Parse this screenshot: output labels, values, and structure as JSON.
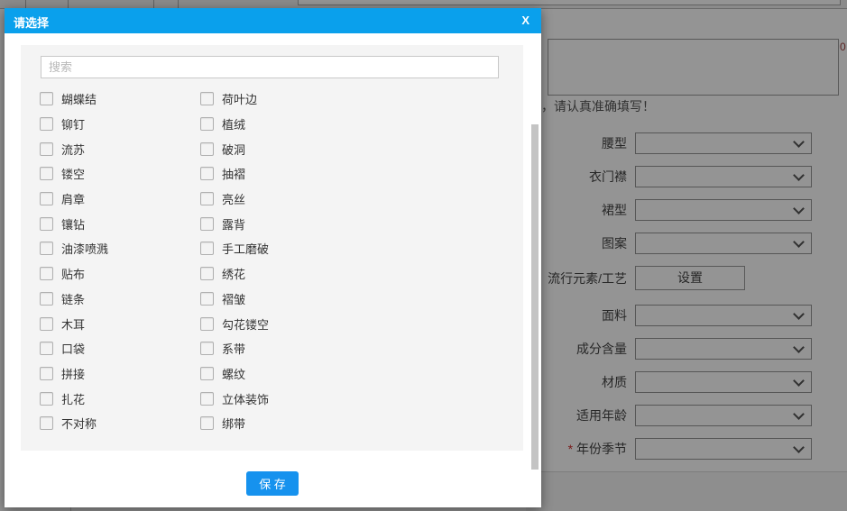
{
  "modal": {
    "title": "请选择",
    "close_label": "X",
    "search": {
      "placeholder": "搜索",
      "value": ""
    },
    "options": [
      {
        "label": "蝴蝶结",
        "checked": false
      },
      {
        "label": "荷叶边",
        "checked": false
      },
      {
        "label": "铆钉",
        "checked": false
      },
      {
        "label": "植绒",
        "checked": false
      },
      {
        "label": "流苏",
        "checked": false
      },
      {
        "label": "破洞",
        "checked": false
      },
      {
        "label": "镂空",
        "checked": false
      },
      {
        "label": "抽褶",
        "checked": false
      },
      {
        "label": "肩章",
        "checked": false
      },
      {
        "label": "亮丝",
        "checked": false
      },
      {
        "label": "镶钻",
        "checked": false
      },
      {
        "label": "露背",
        "checked": false
      },
      {
        "label": "油漆喷溅",
        "checked": false
      },
      {
        "label": "手工磨破",
        "checked": false
      },
      {
        "label": "贴布",
        "checked": false
      },
      {
        "label": "绣花",
        "checked": false
      },
      {
        "label": "链条",
        "checked": false
      },
      {
        "label": "褶皱",
        "checked": false
      },
      {
        "label": "木耳",
        "checked": false
      },
      {
        "label": "勾花镂空",
        "checked": false
      },
      {
        "label": "口袋",
        "checked": false
      },
      {
        "label": "系带",
        "checked": false
      },
      {
        "label": "拼接",
        "checked": false
      },
      {
        "label": "螺纹",
        "checked": false
      },
      {
        "label": "扎花",
        "checked": false
      },
      {
        "label": "立体装饰",
        "checked": false
      },
      {
        "label": "不对称",
        "checked": false
      },
      {
        "label": "绑带",
        "checked": false
      }
    ],
    "save_label": "保 存"
  },
  "background": {
    "notice": "，请认真准确填写！",
    "counter": "0",
    "form": {
      "fields": [
        {
          "label": "腰型",
          "control": "select",
          "value": "",
          "required": false
        },
        {
          "label": "衣门襟",
          "control": "select",
          "value": "",
          "required": false
        },
        {
          "label": "裙型",
          "control": "select",
          "value": "",
          "required": false
        },
        {
          "label": "图案",
          "control": "select",
          "value": "",
          "required": false
        },
        {
          "label": "流行元素/工艺",
          "control": "button",
          "button_label": "设置",
          "required": false
        },
        {
          "label": "面料",
          "control": "select",
          "value": "",
          "required": false
        },
        {
          "label": "成分含量",
          "control": "select",
          "value": "",
          "required": false
        },
        {
          "label": "材质",
          "control": "select",
          "value": "",
          "required": false
        },
        {
          "label": "适用年龄",
          "control": "select",
          "value": "",
          "required": false
        },
        {
          "label": "年份季节",
          "control": "select",
          "value": "",
          "required": true
        }
      ]
    }
  },
  "colors": {
    "header_blue": "#0aa0ec",
    "save_blue": "#1692ee",
    "required_red": "#d03030"
  }
}
